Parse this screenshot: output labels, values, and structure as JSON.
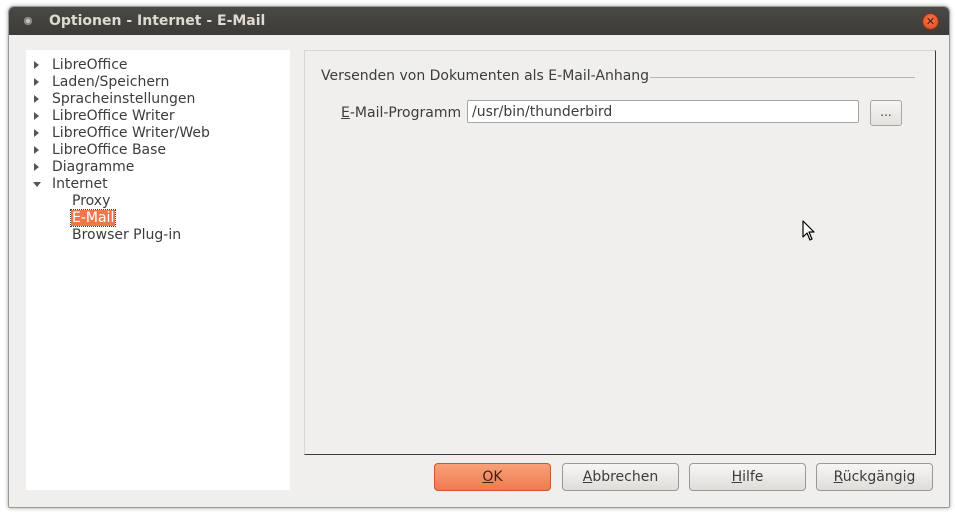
{
  "window": {
    "title": "Optionen - Internet - E-Mail"
  },
  "tree": {
    "items": [
      {
        "label": "LibreOffice",
        "level": 0,
        "expanded": false
      },
      {
        "label": "Laden/Speichern",
        "level": 0,
        "expanded": false
      },
      {
        "label": "Spracheinstellungen",
        "level": 0,
        "expanded": false
      },
      {
        "label": "LibreOffice Writer",
        "level": 0,
        "expanded": false
      },
      {
        "label": "LibreOffice Writer/Web",
        "level": 0,
        "expanded": false
      },
      {
        "label": "LibreOffice Base",
        "level": 0,
        "expanded": false
      },
      {
        "label": "Diagramme",
        "level": 0,
        "expanded": false
      },
      {
        "label": "Internet",
        "level": 0,
        "expanded": true
      },
      {
        "label": "Proxy",
        "level": 1
      },
      {
        "label": "E-Mail",
        "level": 1,
        "selected": true
      },
      {
        "label": "Browser Plug-in",
        "level": 1
      }
    ]
  },
  "content": {
    "section_title": "Versenden von Dokumenten als E-Mail-Anhang",
    "email_program": {
      "label_mnemonic": "E",
      "label_rest": "-Mail-Programm",
      "value": "/usr/bin/thunderbird"
    },
    "browse_label": "..."
  },
  "buttons": {
    "ok": {
      "mnemonic": "O",
      "rest": "K"
    },
    "cancel": {
      "mnemonic": "A",
      "rest": "bbrechen"
    },
    "help": {
      "mnemonic": "H",
      "rest": "ilfe"
    },
    "reset": {
      "mnemonic": "R",
      "rest": "ückgängig"
    }
  },
  "colors": {
    "accent": "#f07746",
    "titlebar": "#3c3b37",
    "dialog_bg": "#f0efed"
  }
}
